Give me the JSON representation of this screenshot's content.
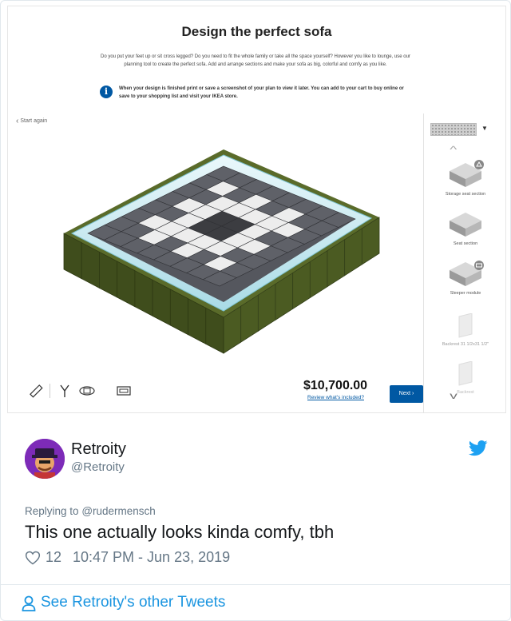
{
  "ikea": {
    "title": "Design the perfect sofa",
    "description": "Do you put your feet up or sit cross legged? Do you need to fit the whole family or take all the space yourself? However you like to lounge, use our planning tool to create the perfect sofa. Add and arrange sections and make your sofa as big, colorful and comfy as you like.",
    "info_text": "When your design is finished print or save a screenshot of your plan to view it later. You can add to your cart to buy online or save to your shopping list and visit your IKEA store.",
    "start_again": "Start again",
    "modules": [
      {
        "label": "Storage seat section"
      },
      {
        "label": "Seat section"
      },
      {
        "label": "Sleeper module"
      },
      {
        "label": "Backrest 31 1/2x31 1/2\""
      },
      {
        "label": "Backrest"
      }
    ],
    "price": "$10,700.00",
    "review_link": "Review what's included?",
    "next_label": "Next",
    "colors": {
      "ikea_blue": "#0058a3",
      "frame_olive": "#4a5a22",
      "cushion_dark": "#5f6168",
      "cushion_white": "#ededed"
    }
  },
  "tweet": {
    "display_name": "Retroity",
    "handle": "@Retroity",
    "replying_prefix": "Replying to",
    "replying_to": "@rudermensch",
    "text": "This one actually looks kinda comfy, tbh",
    "likes": "12",
    "timestamp": "10:47 PM - Jun 23, 2019",
    "see_more": "See Retroity's other Tweets",
    "colors": {
      "twitter_blue": "#1da1f2",
      "link_blue": "#1b95e0",
      "muted": "#657786"
    }
  }
}
